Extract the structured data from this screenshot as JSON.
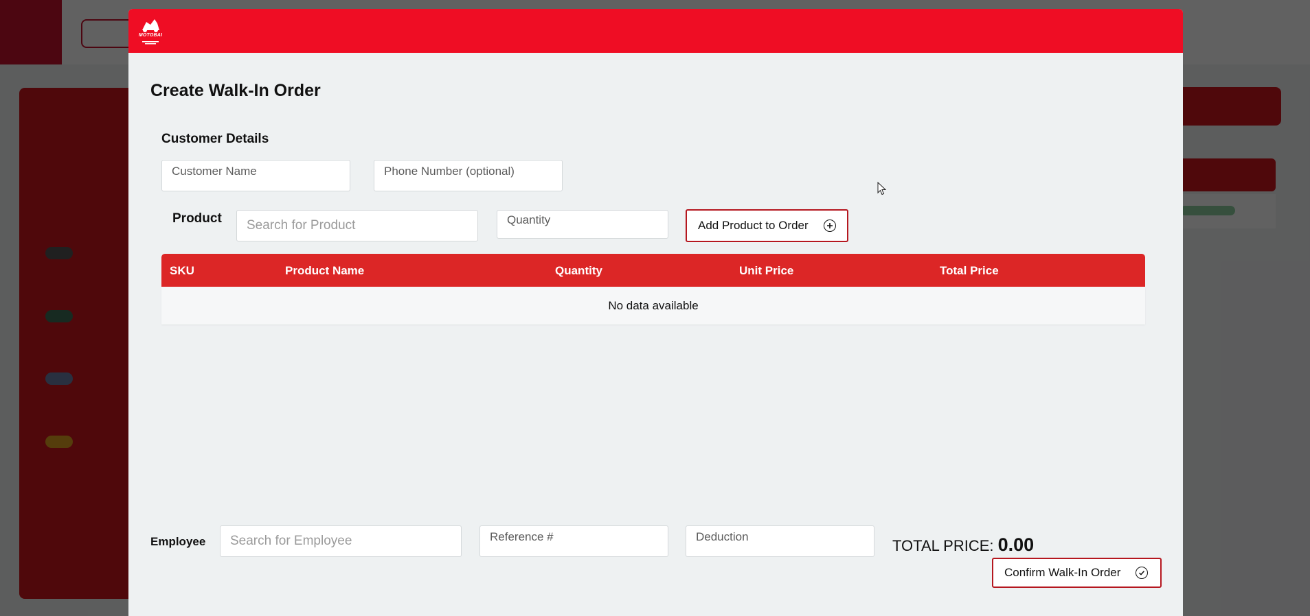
{
  "modal": {
    "logo_text": "MOTOBAI",
    "title": "Create Walk-In Order",
    "customer_section_title": "Customer Details",
    "customer_name_placeholder": "Customer Name",
    "phone_placeholder": "Phone Number (optional)",
    "product_label": "Product",
    "product_search_placeholder": "Search for Product",
    "quantity_placeholder": "Quantity",
    "add_product_label": "Add Product to Order",
    "table": {
      "columns": [
        "SKU",
        "Product Name",
        "Quantity",
        "Unit Price",
        "Total Price"
      ],
      "empty_text": "No data available"
    },
    "employee_label": "Employee",
    "employee_search_placeholder": "Search for Employee",
    "reference_placeholder": "Reference #",
    "deduction_placeholder": "Deduction",
    "total_label": "TOTAL PRICE:",
    "total_value": "0.00",
    "confirm_label": "Confirm Walk-In Order"
  },
  "colors": {
    "header_red": "#ef0d24",
    "table_header_red": "#dc2626",
    "button_border": "#b5171f"
  },
  "icons": {
    "add_icon": "plus-circle-icon",
    "confirm_icon": "check-circle-icon"
  }
}
